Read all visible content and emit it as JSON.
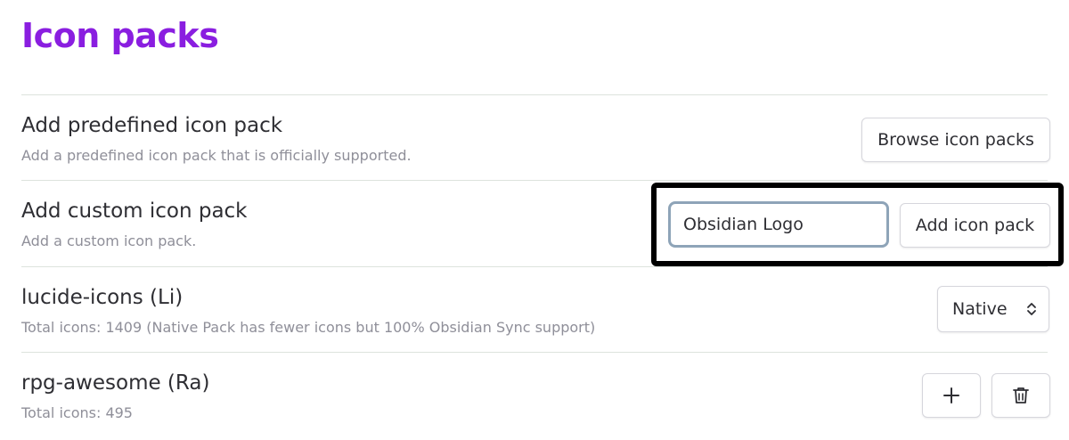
{
  "page": {
    "title": "Icon packs"
  },
  "predefined": {
    "name": "Add predefined icon pack",
    "description": "Add a predefined icon pack that is officially supported.",
    "button_label": "Browse icon packs"
  },
  "custom": {
    "name": "Add custom icon pack",
    "description": "Add a custom icon pack.",
    "input_value": "Obsidian Logo",
    "button_label": "Add icon pack"
  },
  "packs": [
    {
      "name": "lucide-icons (Li)",
      "description": "Total icons: 1409 (Native Pack has fewer icons but 100% Obsidian Sync support)",
      "select_value": "Native",
      "select_icon": "chevron-up-down-icon"
    },
    {
      "name": "rpg-awesome (Ra)",
      "description": "Total icons: 495",
      "actions": [
        "plus-icon",
        "trash-icon"
      ]
    }
  ],
  "colors": {
    "accent": "#8a1ee0",
    "text": "#2e2e33",
    "muted": "#8f8f99",
    "divider": "#dde3dd",
    "input_border": "#8ea4b8",
    "highlight": "#000000"
  }
}
